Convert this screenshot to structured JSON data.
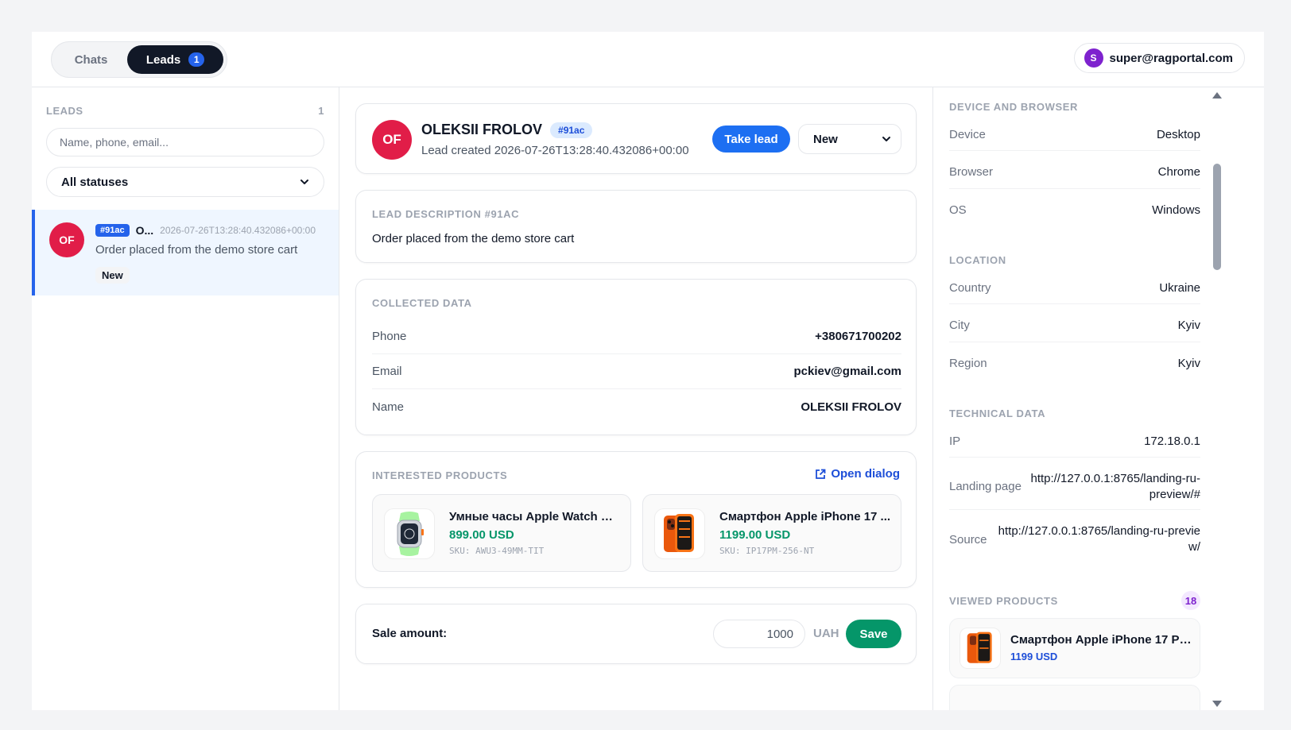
{
  "header": {
    "tabs": [
      {
        "label": "Chats"
      },
      {
        "label": "Leads",
        "badge": "1"
      }
    ],
    "user": {
      "initial": "S",
      "email": "super@ragportal.com"
    }
  },
  "leads_panel": {
    "title": "LEADS",
    "count": "1",
    "search_placeholder": "Name, phone, email...",
    "status_filter": "All statuses",
    "items": [
      {
        "initials": "OF",
        "tag": "#91ac",
        "name": "O...",
        "time": "2026-07-26T13:28:40.432086+00:00",
        "description": "Order placed from the demo store cart",
        "status": "New"
      }
    ]
  },
  "lead": {
    "initials": "OF",
    "name": "OLEKSII FROLOV",
    "tag": "#91ac",
    "created": "Lead created 2026-07-26T13:28:40.432086+00:00",
    "take_label": "Take lead",
    "status": "New"
  },
  "description_card": {
    "title": "LEAD DESCRIPTION #91AC",
    "text": "Order placed from the demo store cart"
  },
  "collected": {
    "title": "COLLECTED DATA",
    "rows": [
      {
        "key": "Phone",
        "value": "+380671700202"
      },
      {
        "key": "Email",
        "value": "pckiev@gmail.com"
      },
      {
        "key": "Name",
        "value": "OLEKSII FROLOV"
      }
    ]
  },
  "products": {
    "title": "INTERESTED PRODUCTS",
    "open_dialog": "Open dialog",
    "items": [
      {
        "name": "Умные часы Apple Watch Ul...",
        "price": "899.00 USD",
        "sku": "SKU: AWU3-49MM-TIT",
        "icon": "watch-icon"
      },
      {
        "name": "Смартфон Apple iPhone 17 ...",
        "price": "1199.00 USD",
        "sku": "SKU: IP17PM-256-NT",
        "icon": "phone-icon"
      }
    ]
  },
  "sale": {
    "label": "Sale amount:",
    "value": "1000",
    "currency": "UAH",
    "save_label": "Save"
  },
  "side": {
    "device_title": "DEVICE AND BROWSER",
    "device": [
      {
        "key": "Device",
        "value": "Desktop"
      },
      {
        "key": "Browser",
        "value": "Chrome"
      },
      {
        "key": "OS",
        "value": "Windows"
      }
    ],
    "location_title": "LOCATION",
    "location": [
      {
        "key": "Country",
        "value": "Ukraine"
      },
      {
        "key": "City",
        "value": "Kyiv"
      },
      {
        "key": "Region",
        "value": "Kyiv"
      }
    ],
    "tech_title": "TECHNICAL DATA",
    "tech": [
      {
        "key": "IP",
        "value": "172.18.0.1"
      },
      {
        "key": "Landing page",
        "value": "http://127.0.0.1:8765/landing-ru-preview/#"
      },
      {
        "key": "Source",
        "value": "http://127.0.0.1:8765/landing-ru-preview/"
      }
    ],
    "viewed_title": "VIEWED PRODUCTS",
    "viewed_count": "18",
    "viewed": [
      {
        "name": "Смартфон Apple iPhone 17 Pro...",
        "price": "1199 USD",
        "icon": "phone-icon"
      }
    ]
  },
  "colors": {
    "accent": "#2563eb",
    "avatar": "#e11d48",
    "success": "#059669",
    "purple": "#7e22ce"
  }
}
